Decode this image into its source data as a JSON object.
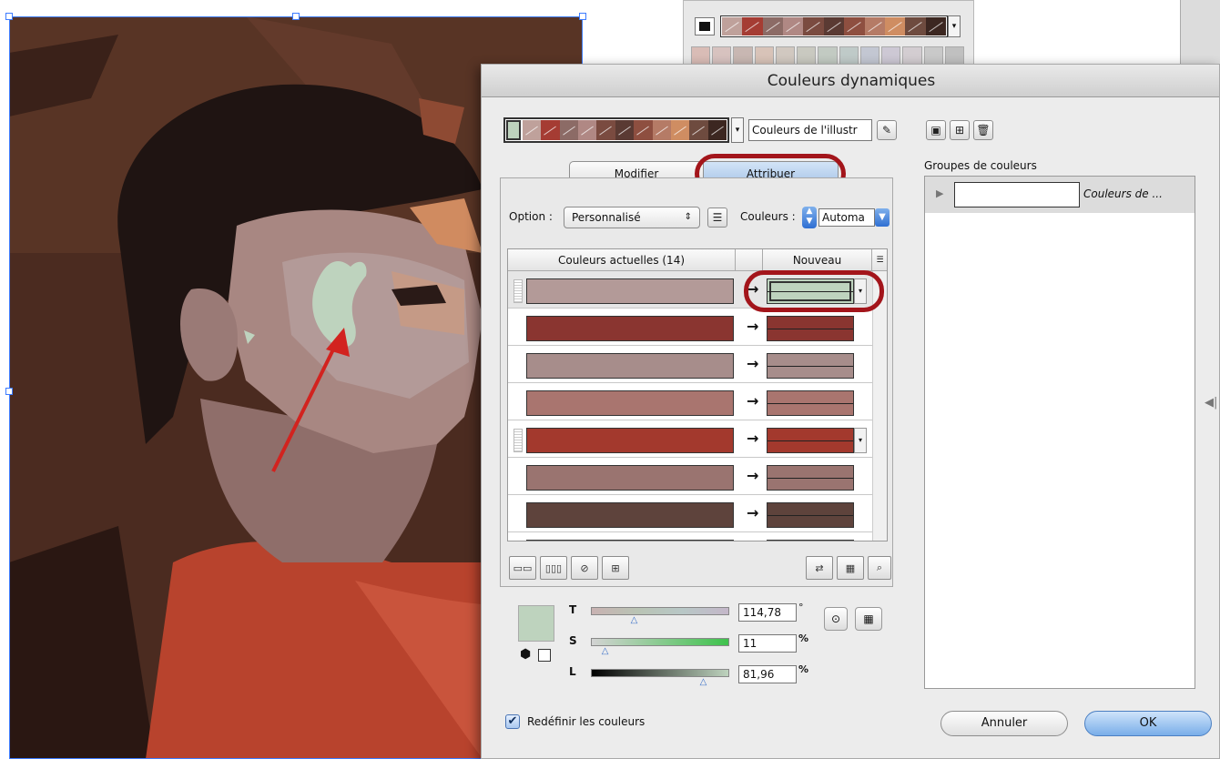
{
  "colors": {
    "accent": "#a9c6e8",
    "annotation": "#a3151b",
    "new_green": "#bed3be"
  },
  "dialog": {
    "title": "Couleurs dynamiques",
    "color_group_name": "Couleurs de l'illustr",
    "tabs": {
      "modify": "Modifier",
      "assign": "Attribuer"
    },
    "option_label": "Option :",
    "option_value": "Personnalisé",
    "colors_label": "Couleurs :",
    "colors_value": "Automa",
    "table": {
      "current_header": "Couleurs actuelles (14)",
      "new_header": "Nouveau",
      "rows": [
        {
          "current": "#b39a98",
          "new": "#bed3be",
          "selected": true
        },
        {
          "current": "#8a3530",
          "new": "#8a3530"
        },
        {
          "current": "#a78d8b",
          "new": "#a78d8b"
        },
        {
          "current": "#a9756f",
          "new": "#a9756f"
        },
        {
          "current": "#a3392d",
          "new": "#a3392d"
        },
        {
          "current": "#9a7470",
          "new": "#9a7470"
        },
        {
          "current": "#5e433c",
          "new": "#5e433c"
        },
        {
          "current": "#6b4a3f",
          "new": "#6b4a3f"
        }
      ]
    },
    "sliders": {
      "h_label": "T",
      "h_value": "114,78",
      "h_unit": "°",
      "h_level": 0.32,
      "s_label": "S",
      "s_value": "11",
      "s_unit": "%",
      "s_level": 0.11,
      "l_label": "L",
      "l_value": "81,96",
      "l_unit": "%",
      "l_level": 0.82
    },
    "recolor_checkbox": {
      "label": "Redéfinir les couleurs",
      "checked": true
    },
    "groups_title": "Groupes de couleurs",
    "group_item": "Couleurs de ...",
    "cancel": "Annuler",
    "ok": "OK"
  },
  "swatch_strip": [
    "#bfa19b",
    "#a53c33",
    "#8c6b66",
    "#b08884",
    "#7a4b40",
    "#5a3a33",
    "#8e4f40",
    "#b57b66",
    "#cf8d62",
    "#6e4b3f",
    "#3c2721"
  ]
}
